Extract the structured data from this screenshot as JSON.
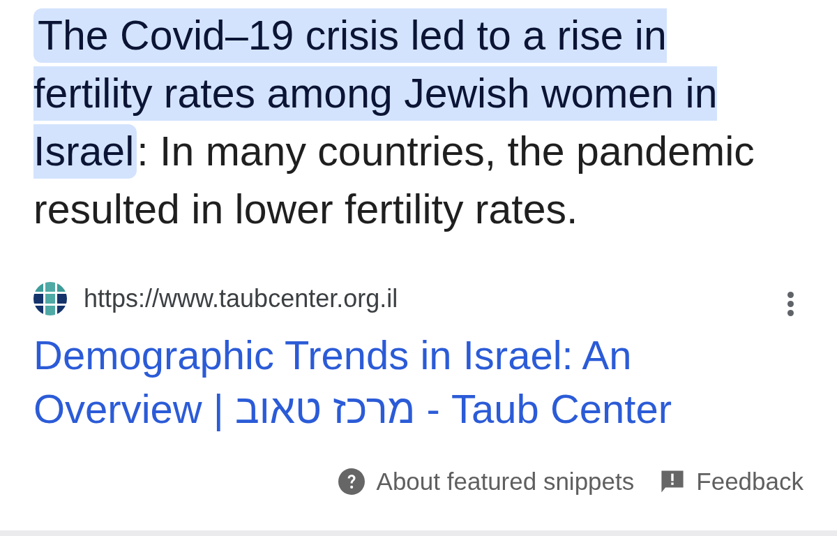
{
  "snippet": {
    "highlighted": "The Covid–19 crisis led to a rise in fertility rates among Jewish women in Israel",
    "rest": ": In many countries, the pandemic resulted in lower fertility rates."
  },
  "source": {
    "url": "https://www.taubcenter.org.il",
    "title": "Demographic Trends in Israel: An Overview | מרכז טאוב - Taub Center"
  },
  "footer": [
    {
      "kind": "about",
      "label": "About featured snippets"
    },
    {
      "kind": "feedback",
      "label": "Feedback"
    }
  ]
}
